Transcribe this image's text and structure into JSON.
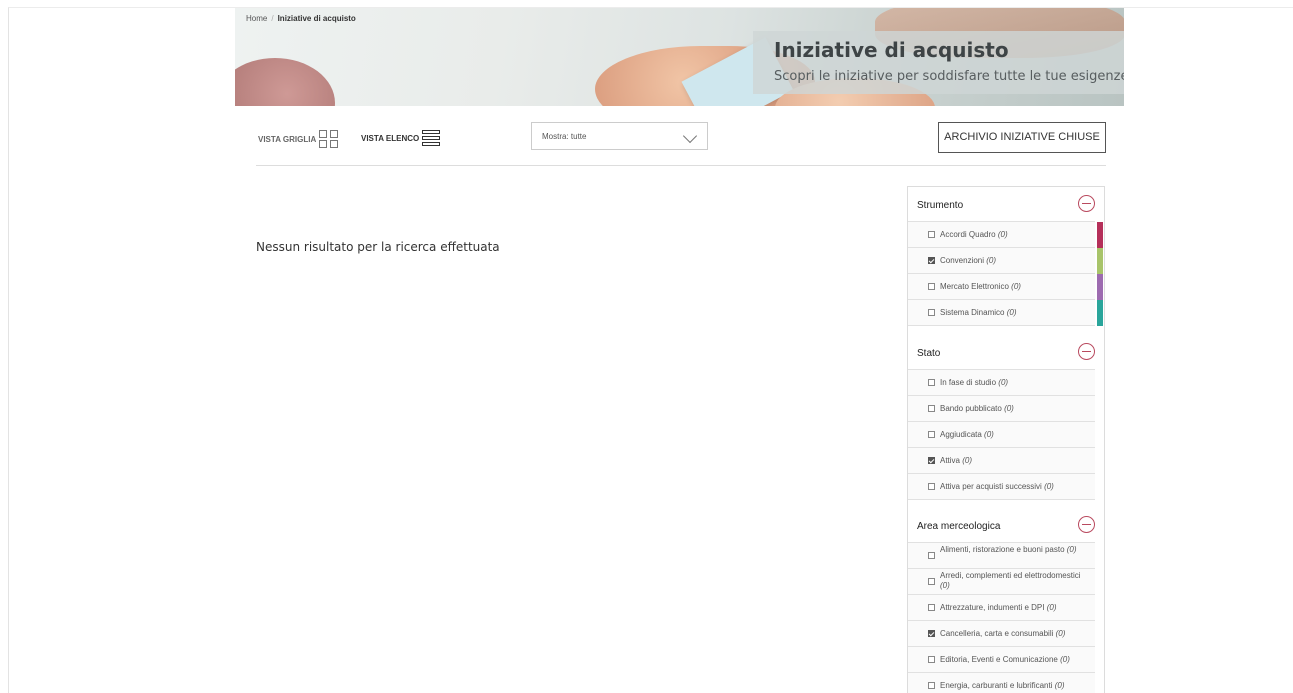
{
  "breadcrumb": {
    "home": "Home",
    "separator": "/",
    "current": "Iniziative di acquisto"
  },
  "hero": {
    "title": "Iniziative di acquisto",
    "subtitle": "Scopri le iniziative per soddisfare tutte le tue esigenze"
  },
  "toolbar": {
    "grid_view_label": "VISTA GRIGLIA",
    "list_view_label": "VISTA ELENCO",
    "filter_select_value": "Mostra: tutte",
    "archive_button": "ARCHIVIO INIZIATIVE CHIUSE"
  },
  "results": {
    "empty_message": "Nessun risultato per la ricerca effettuata"
  },
  "filters": {
    "strumento": {
      "title": "Strumento",
      "options": [
        {
          "label": "Accordi Quadro",
          "count": "(0)",
          "checked": false,
          "color": "#b5305a"
        },
        {
          "label": "Convenzioni",
          "count": "(0)",
          "checked": true,
          "color": "#a8c46a"
        },
        {
          "label": "Mercato Elettronico",
          "count": "(0)",
          "checked": false,
          "color": "#9d6bb0"
        },
        {
          "label": "Sistema Dinamico",
          "count": "(0)",
          "checked": false,
          "color": "#2aa59b"
        }
      ]
    },
    "stato": {
      "title": "Stato",
      "options": [
        {
          "label": "In fase di studio",
          "count": "(0)",
          "checked": false
        },
        {
          "label": "Bando pubblicato",
          "count": "(0)",
          "checked": false
        },
        {
          "label": "Aggiudicata",
          "count": "(0)",
          "checked": false
        },
        {
          "label": "Attiva",
          "count": "(0)",
          "checked": true
        },
        {
          "label": "Attiva per acquisti successivi",
          "count": "(0)",
          "checked": false
        }
      ]
    },
    "area": {
      "title": "Area merceologica",
      "options": [
        {
          "label": "Alimenti, ristorazione e buoni pasto",
          "count": "(0)",
          "checked": false
        },
        {
          "label": "Arredi, complementi ed elettrodomestici",
          "count": "(0)",
          "checked": false
        },
        {
          "label": "Attrezzature, indumenti e DPI",
          "count": "(0)",
          "checked": false
        },
        {
          "label": "Cancelleria, carta e consumabili",
          "count": "(0)",
          "checked": true
        },
        {
          "label": "Editoria, Eventi e Comunicazione",
          "count": "(0)",
          "checked": false
        },
        {
          "label": "Energia, carburanti e lubrificanti",
          "count": "(0)",
          "checked": false
        }
      ]
    }
  }
}
